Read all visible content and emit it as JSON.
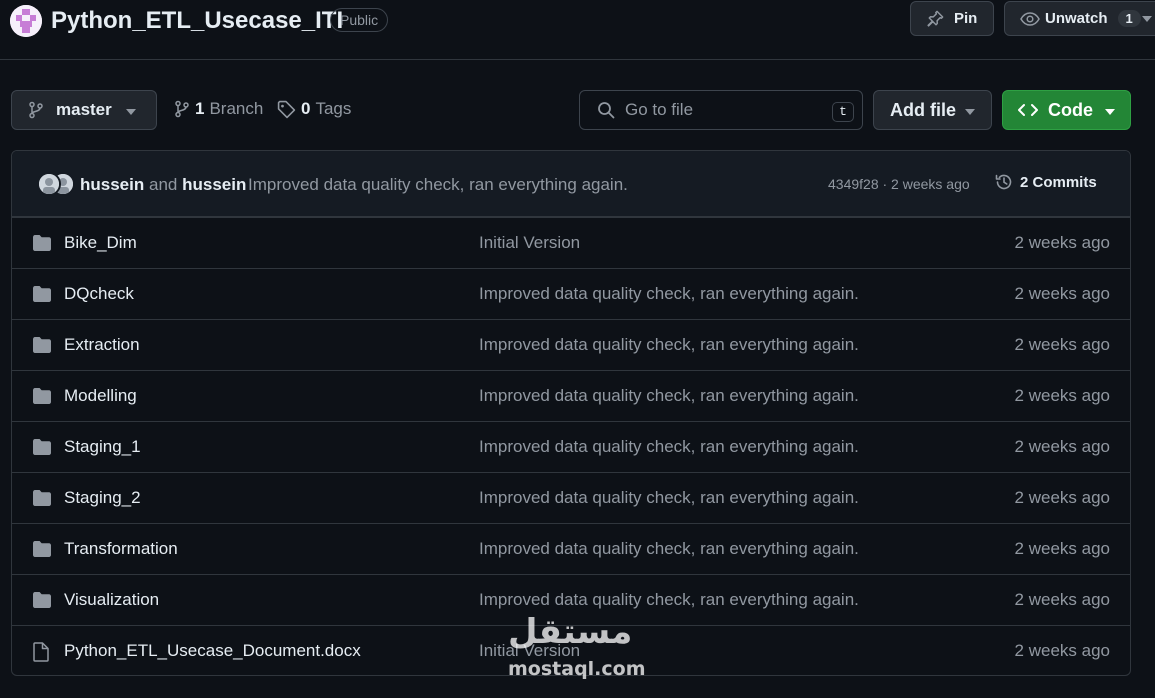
{
  "repo": {
    "title": "Python_ETL_Usecase_ITI",
    "visibility": "Public",
    "pin_label": "Pin",
    "unwatch_label": "Unwatch",
    "watch_count": "1"
  },
  "toolbar": {
    "branch_name": "master",
    "branches_count": "1",
    "branches_label": "Branch",
    "tags_count": "0",
    "tags_label": "Tags",
    "goto_placeholder": "Go to file",
    "goto_kbd": "t",
    "add_file_label": "Add file",
    "code_label": "Code"
  },
  "commit": {
    "author1": "hussein",
    "joiner": "and",
    "author2": "hussein",
    "message": "Improved data quality check, ran everything again.",
    "meta": "4349f28 · 2 weeks ago",
    "commits_label": "2 Commits"
  },
  "files": [
    {
      "name": "Bike_Dim",
      "type": "folder",
      "message": "Initial Version",
      "date": "2 weeks ago"
    },
    {
      "name": "DQcheck",
      "type": "folder",
      "message": "Improved data quality check, ran everything again.",
      "date": "2 weeks ago"
    },
    {
      "name": "Extraction",
      "type": "folder",
      "message": "Improved data quality check, ran everything again.",
      "date": "2 weeks ago"
    },
    {
      "name": "Modelling",
      "type": "folder",
      "message": "Improved data quality check, ran everything again.",
      "date": "2 weeks ago"
    },
    {
      "name": "Staging_1",
      "type": "folder",
      "message": "Improved data quality check, ran everything again.",
      "date": "2 weeks ago"
    },
    {
      "name": "Staging_2",
      "type": "folder",
      "message": "Improved data quality check, ran everything again.",
      "date": "2 weeks ago"
    },
    {
      "name": "Transformation",
      "type": "folder",
      "message": "Improved data quality check, ran everything again.",
      "date": "2 weeks ago"
    },
    {
      "name": "Visualization",
      "type": "folder",
      "message": "Improved data quality check, ran everything again.",
      "date": "2 weeks ago"
    },
    {
      "name": "Python_ETL_Usecase_Document.docx",
      "type": "file",
      "message": "Initial Version",
      "date": "2 weeks ago"
    }
  ],
  "watermark": {
    "arabic": "مستقل",
    "latin": "mostaql.com"
  },
  "colors": {
    "background": "#0d1117",
    "border": "#30363d",
    "code_button": "#238636",
    "muted_text": "#9198a1"
  }
}
